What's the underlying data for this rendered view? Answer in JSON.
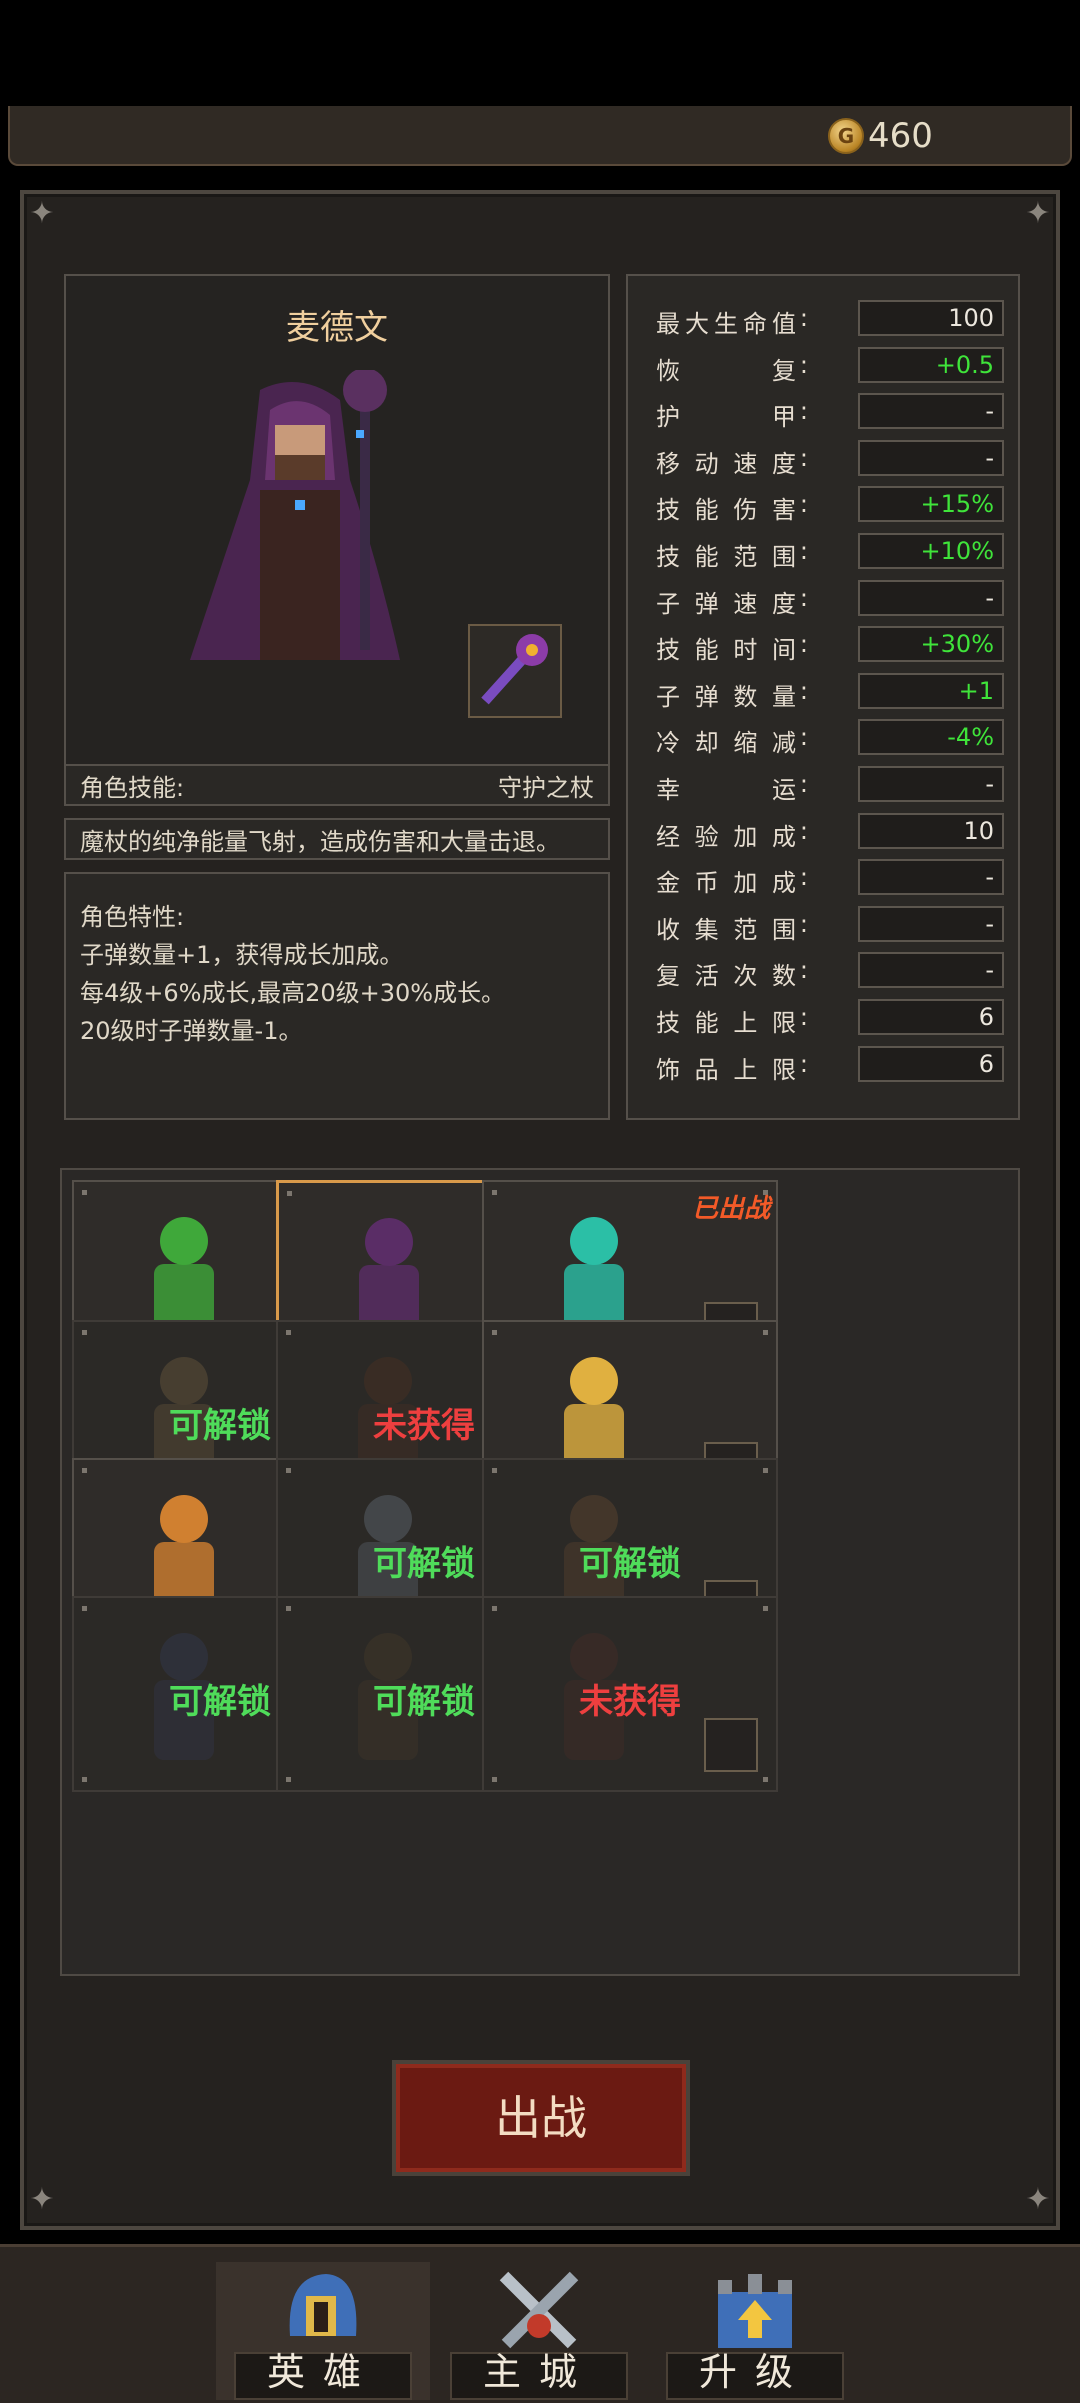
{
  "header": {
    "gold": "460",
    "coin_glyph": "G"
  },
  "hero": {
    "name": "麦德文",
    "skill_label": "角色技能:",
    "skill_name": "守护之杖",
    "description": "魔杖的纯净能量飞射，造成伤害和大量击退。",
    "traits_title": "角色特性:",
    "traits": [
      "子弹数量+1，获得成长加成。",
      "每4级+6%成长,最高20级+30%成长。",
      "20级时子弹数量-1。"
    ]
  },
  "stats": [
    {
      "label": "最大生命值",
      "value": "100",
      "green": false
    },
    {
      "label": "恢复",
      "value": "+0.5",
      "green": true
    },
    {
      "label": "护甲",
      "value": "-",
      "green": false
    },
    {
      "label": "移动速度",
      "value": "-",
      "green": false
    },
    {
      "label": "技能伤害",
      "value": "+15%",
      "green": true
    },
    {
      "label": "技能范围",
      "value": "+10%",
      "green": true
    },
    {
      "label": "子弹速度",
      "value": "-",
      "green": false
    },
    {
      "label": "技能时间",
      "value": "+30%",
      "green": true
    },
    {
      "label": "子弹数量",
      "value": "+1",
      "green": true
    },
    {
      "label": "冷却缩减",
      "value": "-4%",
      "green": true
    },
    {
      "label": "幸运",
      "value": "-",
      "green": false
    },
    {
      "label": "经验加成",
      "value": "10",
      "green": false
    },
    {
      "label": "金币加成",
      "value": "-",
      "green": false
    },
    {
      "label": "收集范围",
      "value": "-",
      "green": false
    },
    {
      "label": "复活次数",
      "value": "-",
      "green": false
    },
    {
      "label": "技能上限",
      "value": "6",
      "green": false
    },
    {
      "label": "饰品上限",
      "value": "6",
      "green": false
    }
  ],
  "roster": {
    "deployed_label": "已出战",
    "cards": [
      {
        "status": "",
        "state": "owned"
      },
      {
        "status": "",
        "state": "selected"
      },
      {
        "status": "",
        "state": "deployed"
      },
      {
        "status": "可解锁",
        "state": "unlockable"
      },
      {
        "status": "未获得",
        "state": "notowned"
      },
      {
        "status": "",
        "state": "owned"
      },
      {
        "status": "",
        "state": "owned"
      },
      {
        "status": "可解锁",
        "state": "unlockable"
      },
      {
        "status": "可解锁",
        "state": "unlockable"
      },
      {
        "status": "可解锁",
        "state": "unlockable"
      },
      {
        "status": "可解锁",
        "state": "unlockable"
      },
      {
        "status": "未获得",
        "state": "notowned"
      }
    ]
  },
  "battle_button": "出战",
  "nav": [
    {
      "label": "英雄",
      "active": true
    },
    {
      "label": "主城",
      "active": false
    },
    {
      "label": "升级",
      "active": false
    }
  ]
}
